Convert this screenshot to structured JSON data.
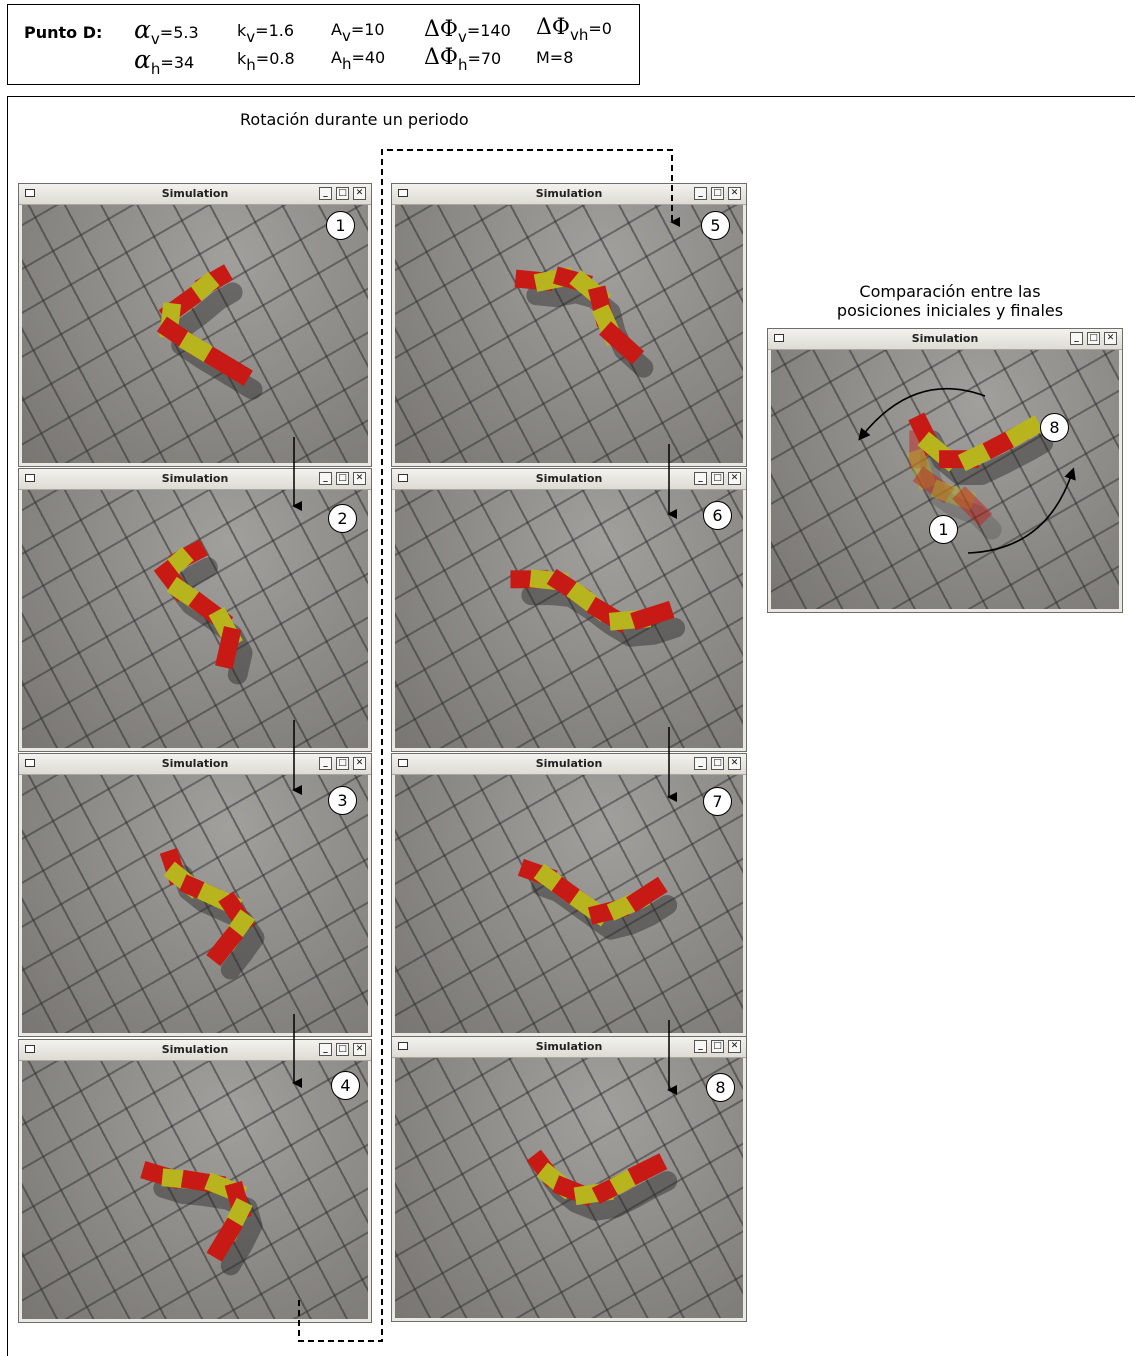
{
  "params": {
    "title": "Punto D:",
    "alpha_v": "=5.3",
    "alpha_h": "=34",
    "k_v": "=1.6",
    "k_h": "=0.8",
    "A_v": "=10",
    "A_h": "=40",
    "dphi_v": "=140",
    "dphi_h": "=70",
    "dphi_vh": "=0",
    "M": "M=8",
    "sym_alpha": "α",
    "sym_delta_phi": "ΔΦ",
    "sym_k": "k",
    "sym_A": "A",
    "sub_v": "v",
    "sub_h": "h",
    "sub_vh": "vh"
  },
  "captions": {
    "rotation": "Rotación durante un periodo",
    "comparison_line1": "Comparación entre las",
    "comparison_line2": "posiciones iniciales y finales"
  },
  "window": {
    "title": "Simulation",
    "minimize": "_",
    "maximize": "□",
    "close": "✕"
  },
  "steps": [
    "1",
    "2",
    "3",
    "4",
    "5",
    "6",
    "7",
    "8"
  ],
  "comparison": {
    "start": "1",
    "end": "8"
  },
  "colors": {
    "red": "#c81a14",
    "yellow": "#b8b41e",
    "floor": "#8d8a86"
  }
}
